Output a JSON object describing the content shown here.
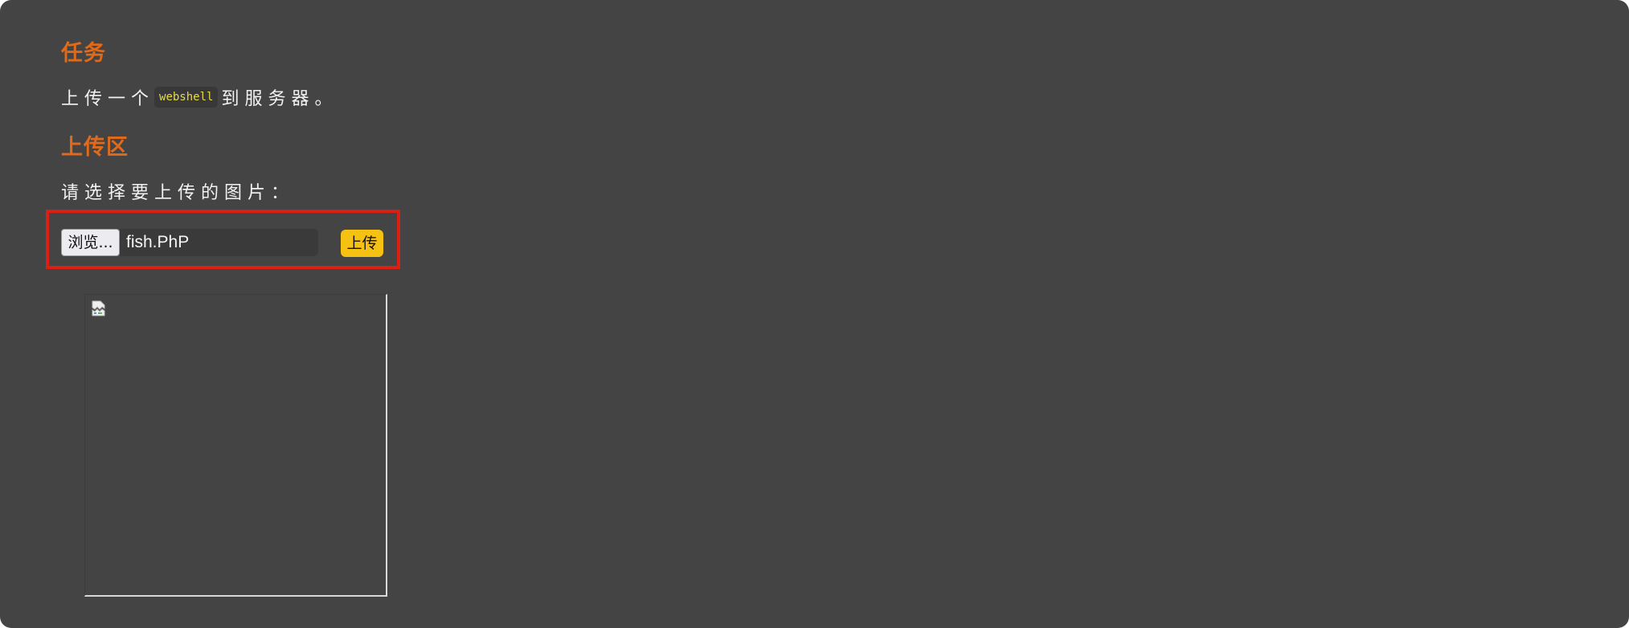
{
  "task": {
    "heading": "任务",
    "text_before": "上传一个",
    "code": "webshell",
    "text_after": "到服务器。"
  },
  "upload": {
    "heading": "上传区",
    "prompt": "请选择要上传的图片：",
    "browse_label": "浏览...",
    "file_name": "fish.PhP",
    "submit_label": "上传"
  },
  "preview": {
    "icon": "broken-image-icon"
  },
  "colors": {
    "background": "#444444",
    "heading": "#e06a1b",
    "code_text": "#e6d94a",
    "submit_button": "#f5c112",
    "highlight_border": "#dd1f13"
  }
}
